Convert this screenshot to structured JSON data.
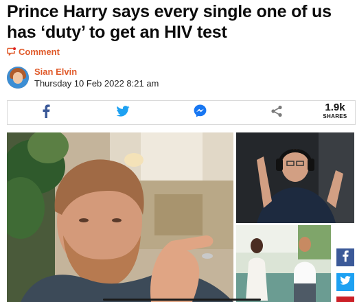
{
  "article": {
    "headline": "Prince Harry says every single one of us has ‘duty’ to get an HIV test",
    "comment_label": "Comment",
    "author": "Sian Elvin",
    "timestamp": "Thursday 10 Feb 2022 8:21 am"
  },
  "share_bar": {
    "buttons": [
      {
        "icon": "facebook-icon"
      },
      {
        "icon": "twitter-icon"
      },
      {
        "icon": "messenger-icon"
      },
      {
        "icon": "share-icon"
      }
    ],
    "count": "1.9k",
    "count_label": "SHARES"
  },
  "side_share": [
    {
      "icon": "facebook-icon"
    },
    {
      "icon": "twitter-icon"
    },
    {
      "icon": "pinterest-icon"
    }
  ],
  "colors": {
    "accent": "#e05a2a",
    "facebook": "#3b5998",
    "twitter": "#1da1f2",
    "messenger": "#1877f2",
    "share_grey": "#7a7a7a"
  }
}
